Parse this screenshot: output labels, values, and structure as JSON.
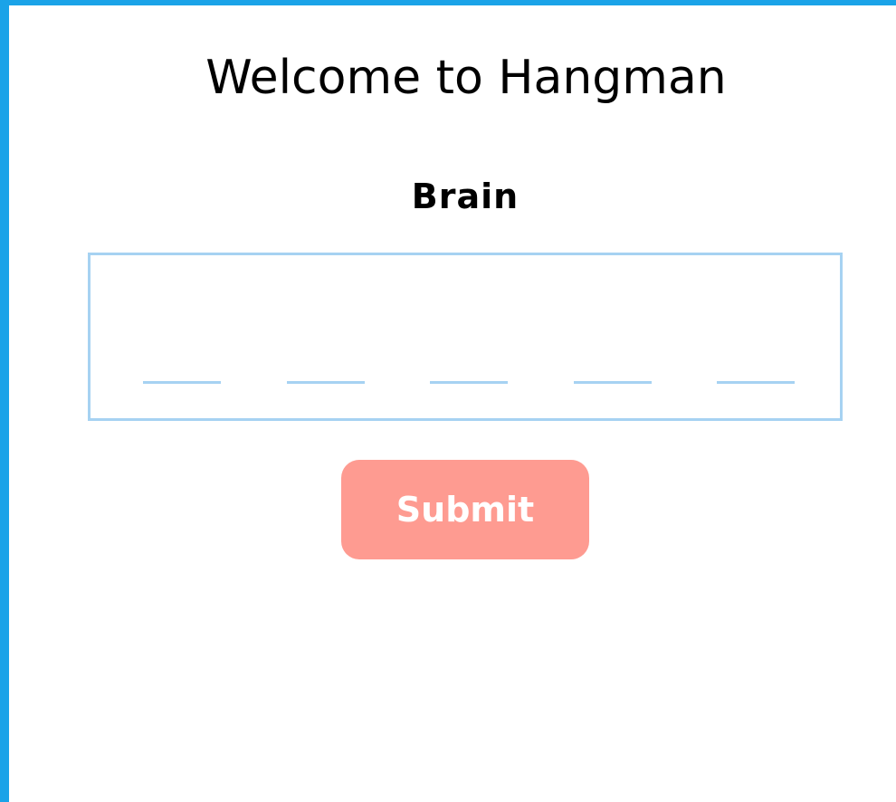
{
  "game": {
    "title": "Welcome to Hangman",
    "hint_word": "Brain",
    "blanks": [
      "",
      "",
      "",
      "",
      ""
    ],
    "submit_label": "Submit"
  },
  "colors": {
    "frame_border": "#1aa3e8",
    "word_box_border": "#a6d2f2",
    "submit_background": "#fe9b91",
    "submit_text": "#ffffff"
  }
}
